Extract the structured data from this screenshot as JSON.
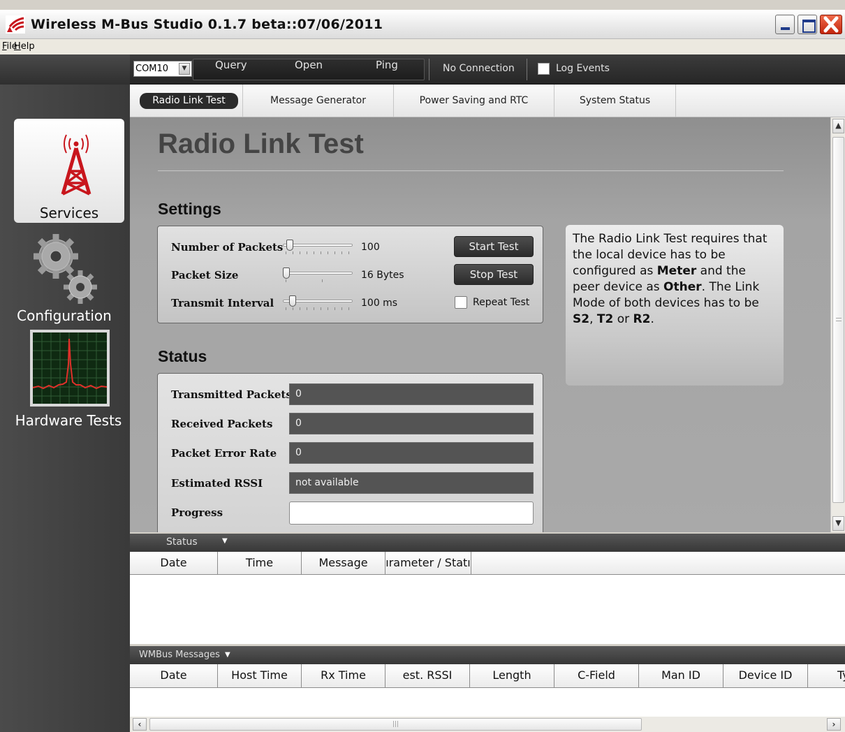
{
  "window": {
    "title": "Wireless M-Bus Studio  0.1.7 beta::07/06/2011"
  },
  "menu": {
    "file": "File",
    "help": "Help"
  },
  "toolbar": {
    "com_port": "COM10",
    "query": "Query",
    "open": "Open",
    "ping": "Ping",
    "connection_status": "No Connection",
    "log_events": "Log Events",
    "log_events_checked": false
  },
  "sidebar": {
    "items": [
      {
        "label": "Services",
        "icon": "radio-tower-icon",
        "selected": true
      },
      {
        "label": "Configuration",
        "icon": "gears-icon",
        "selected": false
      },
      {
        "label": "Hardware Tests",
        "icon": "spectrum-analyzer-icon",
        "selected": false
      }
    ]
  },
  "tabs": [
    {
      "label": "Radio Link Test",
      "active": true
    },
    {
      "label": "Message Generator",
      "active": false
    },
    {
      "label": "Power Saving and RTC",
      "active": false
    },
    {
      "label": "System Status",
      "active": false
    }
  ],
  "page": {
    "title": "Radio Link Test",
    "settings_heading": "Settings",
    "status_heading": "Status"
  },
  "settings": {
    "packets_label": "Number of Packets",
    "packets_value": "100",
    "packets_level": 0.05,
    "size_label": "Packet Size",
    "size_value": "16  Bytes",
    "size_level": 0.0,
    "interval_label": "Transmit Interval",
    "interval_value": "100  ms",
    "interval_level": 0.1,
    "start_label": "Start Test",
    "stop_label": "Stop Test",
    "repeat_label": "Repeat Test",
    "repeat_checked": false
  },
  "info": {
    "text_1": "The Radio Link Test requires that the local device has to be configured as ",
    "meter": "Meter",
    "text_2": " and the peer device as ",
    "other": "Other",
    "text_3": ". The Link Mode of both devices has to be ",
    "s2": "S2",
    "sep1": ", ",
    "t2": "T2",
    "sep2": " or ",
    "r2": "R2",
    "end": "."
  },
  "status": {
    "transmitted_label": "Transmitted Packets",
    "transmitted_value": "0",
    "received_label": "Received Packets",
    "received_value": "0",
    "per_label": "Packet Error Rate",
    "per_value": "0",
    "rssi_label": "Estimated RSSI",
    "rssi_value": "not available",
    "progress_label": "Progress",
    "progress_level": 0.0
  },
  "status_log": {
    "title": "Status",
    "columns": [
      "Date",
      "Time",
      "Message",
      "ırameter / Statı"
    ]
  },
  "wmbus_log": {
    "title": "WMBus Messages",
    "columns": [
      "Date",
      "Host Time",
      "Rx Time",
      "est. RSSI",
      "Length",
      "C-Field",
      "Man ID",
      "Device ID",
      "Ty"
    ]
  },
  "colors": {
    "sidebar_bg": "#414141",
    "toolbar_bg": "#2c2c2c",
    "accent_red": "#c8161d",
    "content_bg": "#a6a6a6"
  }
}
